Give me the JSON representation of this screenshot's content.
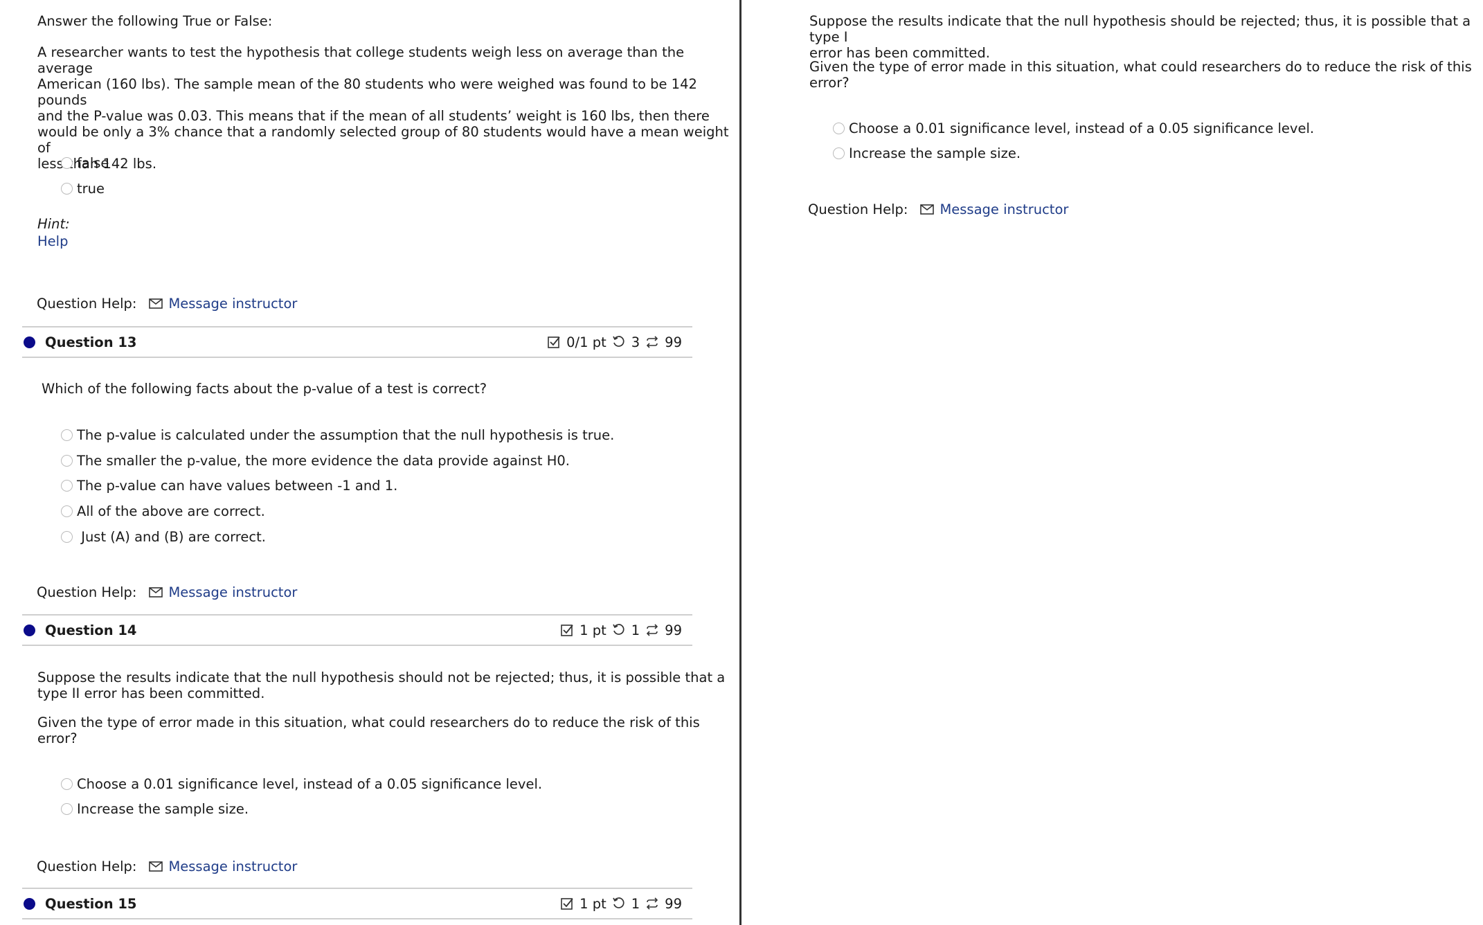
{
  "left": {
    "q12": {
      "instruction": "Answer the following True or False:",
      "body": [
        "A researcher wants to test the hypothesis that college students weigh less on average than the average",
        "American (160 lbs). The sample mean of the 80 students who were weighed was found to be 142 pounds",
        "and the P-value was 0.03. This means that if the mean of all students’ weight is 160 lbs, then there",
        "would be only a 3% chance that a randomly selected group of 80 students would have a mean weight of",
        "less than 142 lbs."
      ],
      "options": [
        "false",
        "true"
      ],
      "hint_label": "Hint:",
      "hint_link": "Help",
      "help_label": "Question Help:",
      "help_link": "Message instructor"
    },
    "q13": {
      "title": "Question 13",
      "score": "0/1 pt",
      "attempts": "3",
      "tries": "99",
      "prompt": "Which of the following facts about the p-value of a test is correct?",
      "options": [
        "The p-value is calculated under the assumption that the null hypothesis is true.",
        "The smaller the p-value, the more evidence the data provide against H0.",
        "The p-value can have values between -1 and 1.",
        "All of the above are correct.",
        " Just (A) and (B) are correct."
      ],
      "help_label": "Question Help:",
      "help_link": "Message instructor"
    },
    "q14": {
      "title": "Question 14",
      "score": "1 pt",
      "attempts": "1",
      "tries": "99",
      "para1": [
        "Suppose the results indicate that the null hypothesis should not be rejected; thus, it is possible that a",
        "type II error has been committed."
      ],
      "para2": [
        "Given the type of error made in this situation, what could researchers do to reduce the risk of this",
        "error?"
      ],
      "options": [
        "Choose a 0.01 significance level, instead of a 0.05 significance level.",
        "Increase the sample size."
      ],
      "help_label": "Question Help:",
      "help_link": "Message instructor"
    },
    "q15": {
      "title": "Question 15",
      "score": "1 pt",
      "attempts": "1",
      "tries": "99"
    }
  },
  "right": {
    "para1": [
      "Suppose the results indicate that the null hypothesis should be rejected; thus, it is possible that a type I",
      "error has been committed."
    ],
    "para2": [
      "Given the type of error made in this situation, what could researchers do to reduce the risk of this",
      "error?"
    ],
    "options": [
      "Choose a 0.01 significance level, instead of a 0.05 significance level.",
      "Increase the sample size."
    ],
    "help_label": "Question Help:",
    "help_link": "Message instructor"
  },
  "colors": {
    "link": "#1f3c88",
    "question_dot": "#0b0b8a",
    "rule": "#cfcfcf"
  },
  "icons": [
    "mail-icon",
    "score-check-icon",
    "retry-icon",
    "tries-icon",
    "radio-icon"
  ]
}
